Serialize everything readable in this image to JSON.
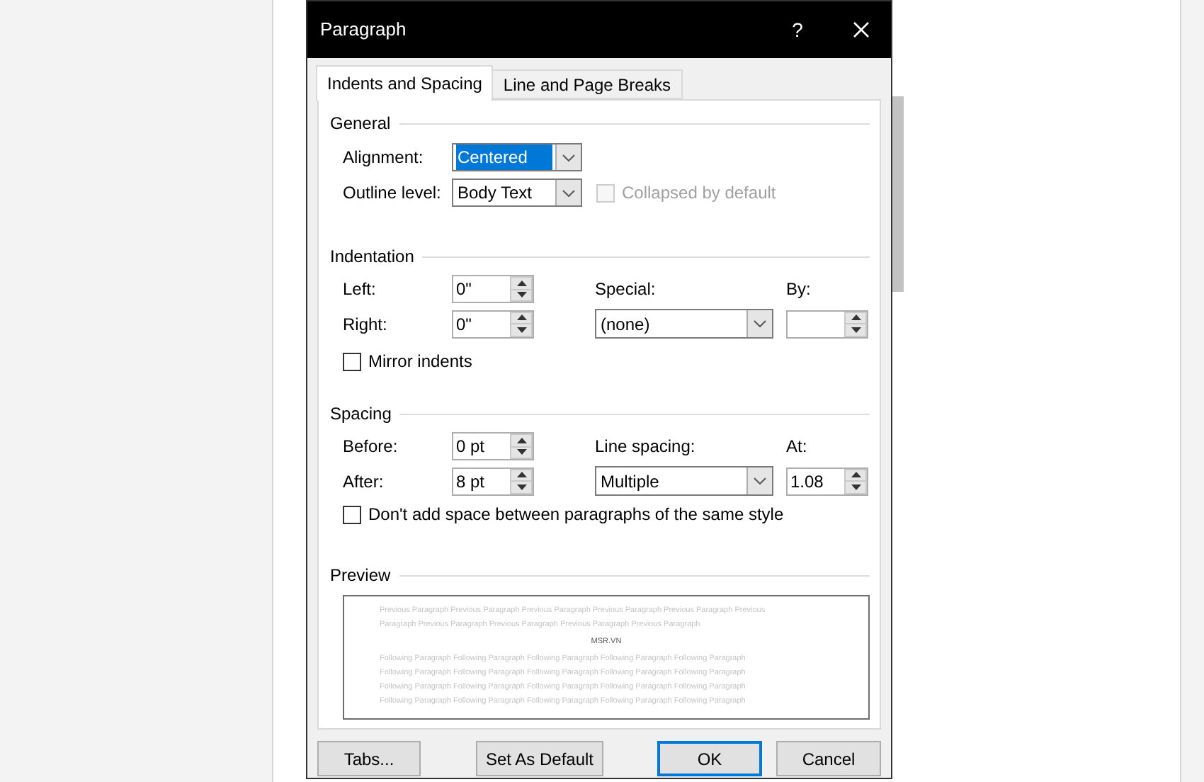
{
  "window": {
    "title": "Paragraph",
    "help": "?"
  },
  "tabs": [
    {
      "label": "Indents and Spacing",
      "selected": true
    },
    {
      "label": "Line and Page Breaks",
      "selected": false
    }
  ],
  "general": {
    "heading": "General",
    "alignment": {
      "label": "Alignment:",
      "value": "Centered",
      "focused": true
    },
    "outline_level": {
      "label": "Outline level:",
      "value": "Body Text",
      "focused": false
    },
    "collapsed": {
      "label": "Collapsed by default",
      "checked": false,
      "disabled": true
    }
  },
  "indentation": {
    "heading": "Indentation",
    "left": {
      "label": "Left:",
      "value": "0\""
    },
    "right": {
      "label": "Right:",
      "value": "0\""
    },
    "special": {
      "label": "Special:",
      "value": "(none)",
      "focused": false
    },
    "by": {
      "label": "By:"
    },
    "mirror": {
      "label": "Mirror indents",
      "checked": false,
      "disabled": false
    }
  },
  "spacing": {
    "heading": "Spacing",
    "before": {
      "label": "Before:",
      "value": "0 pt"
    },
    "after": {
      "label": "After:",
      "value": "8 pt"
    },
    "line_spacing": {
      "label": "Line spacing:",
      "value": "Multiple",
      "focused": false
    },
    "at": {
      "label": "At:",
      "value": "1.08"
    },
    "dont_add": {
      "label": "Don't add space between paragraphs of the same style",
      "checked": false,
      "disabled": false
    }
  },
  "preview": {
    "heading": "Preview",
    "previous_lines": [
      "Previous Paragraph Previous Paragraph Previous Paragraph Previous Paragraph Previous Paragraph Previous",
      "Paragraph Previous Paragraph Previous Paragraph Previous Paragraph Previous Paragraph"
    ],
    "sample": "MSR.VN",
    "following_lines": [
      "Following Paragraph Following Paragraph Following Paragraph Following Paragraph Following Paragraph",
      "Following Paragraph Following Paragraph Following Paragraph Following Paragraph Following Paragraph",
      "Following Paragraph Following Paragraph Following Paragraph Following Paragraph Following Paragraph",
      "Following Paragraph Following Paragraph Following Paragraph Following Paragraph Following Paragraph"
    ]
  },
  "buttons": [
    {
      "label": "Tabs...",
      "default": false
    },
    {
      "label": "Set As Default",
      "default": false
    },
    {
      "label": "OK",
      "default": true
    },
    {
      "label": "Cancel",
      "default": false
    }
  ]
}
